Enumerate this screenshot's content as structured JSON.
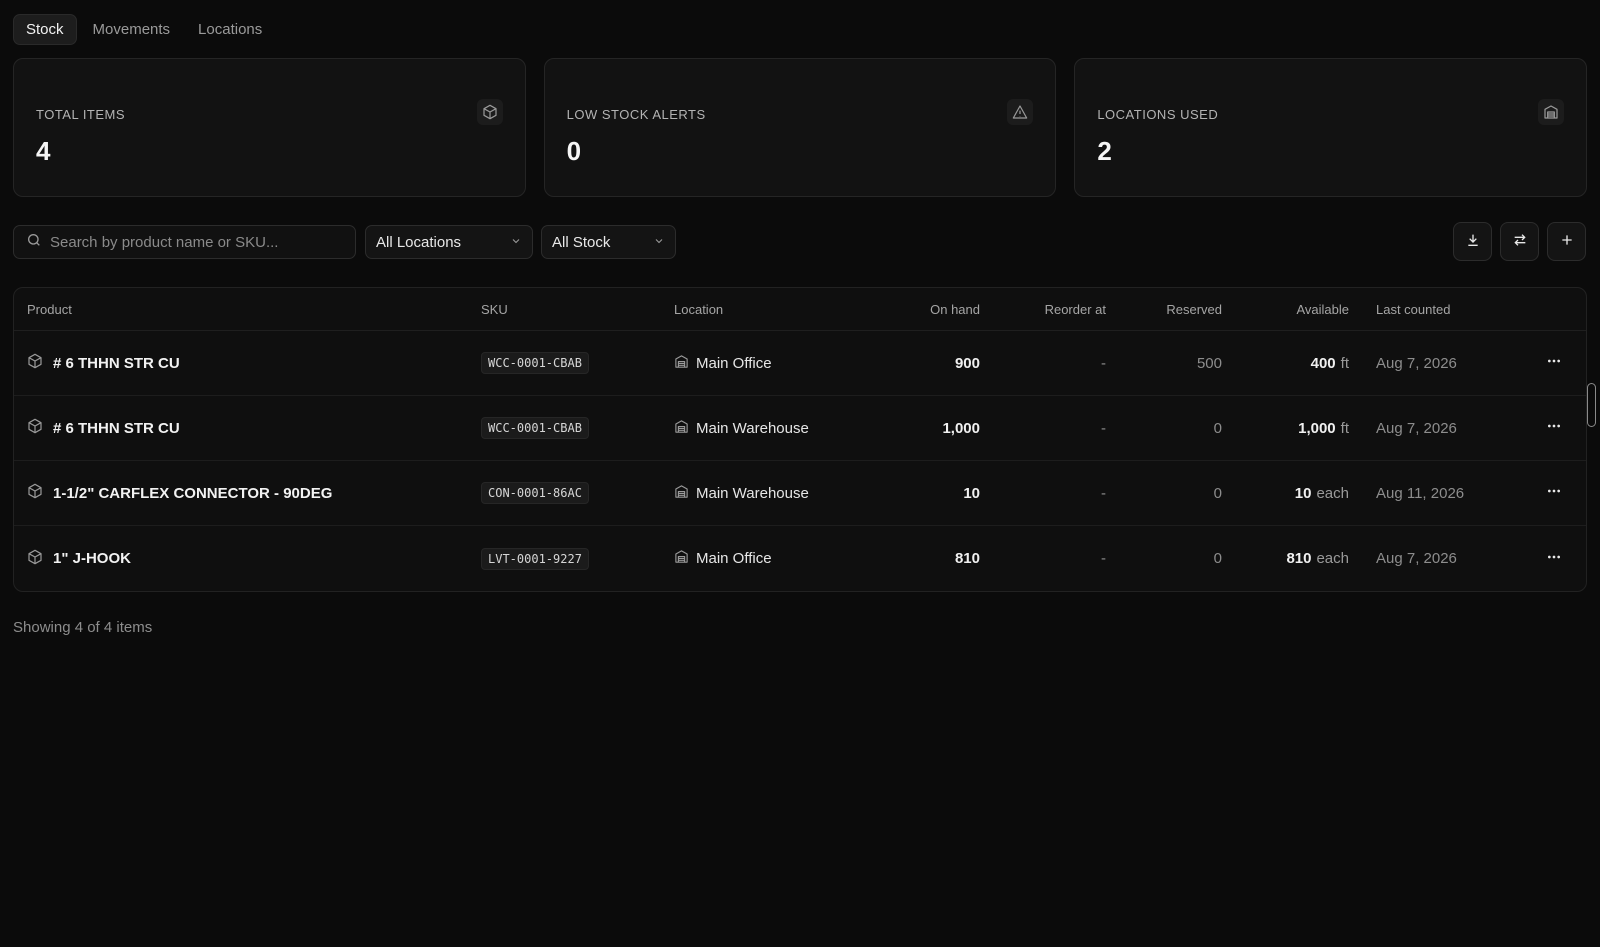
{
  "tabs": [
    {
      "label": "Stock",
      "active": true
    },
    {
      "label": "Movements",
      "active": false
    },
    {
      "label": "Locations",
      "active": false
    }
  ],
  "cards": [
    {
      "label": "TOTAL ITEMS",
      "value": "4",
      "icon": "box-icon"
    },
    {
      "label": "LOW STOCK ALERTS",
      "value": "0",
      "icon": "alert-triangle-icon"
    },
    {
      "label": "LOCATIONS USED",
      "value": "2",
      "icon": "warehouse-icon"
    }
  ],
  "toolbar": {
    "search_placeholder": "Search by product name or SKU...",
    "location_filter": "All Locations",
    "stock_filter": "All Stock"
  },
  "table": {
    "headers": {
      "product": "Product",
      "sku": "SKU",
      "location": "Location",
      "on_hand": "On hand",
      "reorder_at": "Reorder at",
      "reserved": "Reserved",
      "available": "Available",
      "last_counted": "Last counted"
    },
    "rows": [
      {
        "product": "# 6 THHN STR CU",
        "sku": "WCC-0001-CBAB",
        "location": "Main Office",
        "on_hand": "900",
        "reorder_at": "-",
        "reserved": "500",
        "available": "400",
        "unit": "ft",
        "last_counted": "Aug 7, 2026"
      },
      {
        "product": "# 6 THHN STR CU",
        "sku": "WCC-0001-CBAB",
        "location": "Main Warehouse",
        "on_hand": "1,000",
        "reorder_at": "-",
        "reserved": "0",
        "available": "1,000",
        "unit": "ft",
        "last_counted": "Aug 7, 2026"
      },
      {
        "product": "1-1/2\" CARFLEX CONNECTOR - 90DEG",
        "sku": "CON-0001-86AC",
        "location": "Main Warehouse",
        "on_hand": "10",
        "reorder_at": "-",
        "reserved": "0",
        "available": "10",
        "unit": "each",
        "last_counted": "Aug 11, 2026"
      },
      {
        "product": "1\" J-HOOK",
        "sku": "LVT-0001-9227",
        "location": "Main Office",
        "on_hand": "810",
        "reorder_at": "-",
        "reserved": "0",
        "available": "810",
        "unit": "each",
        "last_counted": "Aug 7, 2026"
      }
    ]
  },
  "footer": {
    "text": "Showing 4 of 4 items"
  }
}
